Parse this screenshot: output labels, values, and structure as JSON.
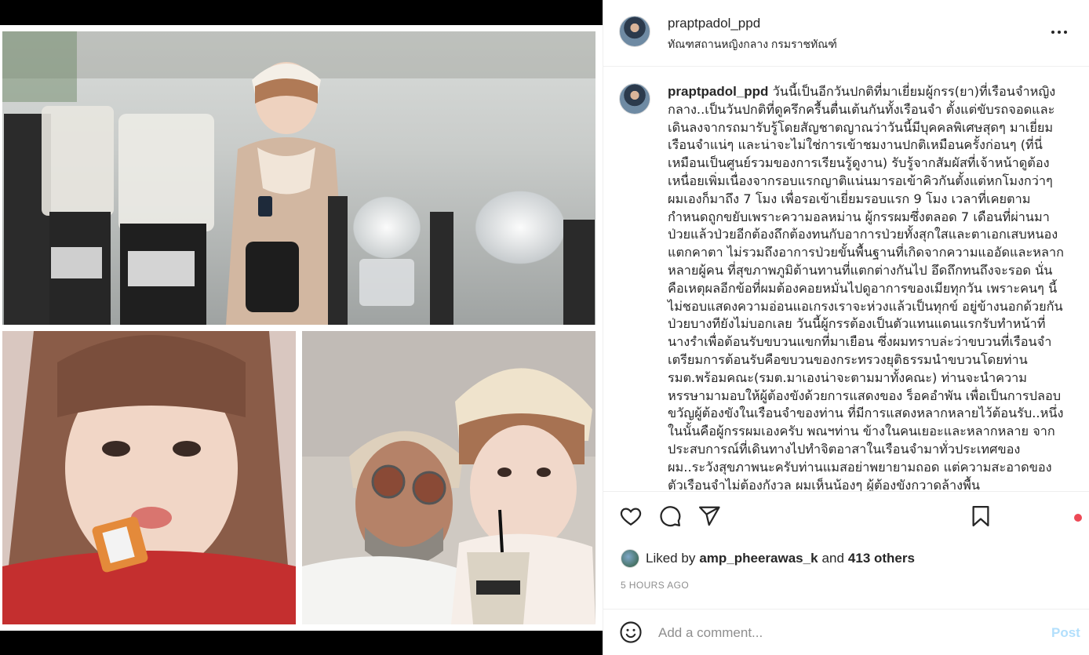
{
  "post": {
    "username": "praptpadol_ppd",
    "location": "ทัณฑสถานหญิงกลาง กรมราชทัณฑ์"
  },
  "caption": {
    "username": "praptpadol_ppd",
    "text": "วันนี้เป็นอีกวันปกติที่มาเยี่ยมผู้กรร(ยา)ที่เรือนจำหญิงกลาง..เป็นวันปกติที่ดูครึกครื้นตื่นเต้นกันทั้งเรือนจำ ตั้งแต่ขับรถจอดและเดินลงจากรถมารับรู้โดยสัญชาตญาณว่าวันนี้มีบุคคลพิเศษสุดๆ มาเยี่ยมเรือนจำแน่ๆ และน่าจะไม่ใช่การเข้าชมงานปกติเหมือนครั้งก่อนๆ (ที่นี่เหมือนเป็นศูนย์รวมของการเรียนรู้ดูงาน) รับรู้จากสัมผัสที่เจ้าหน้าดูต้องเหนื่อยเพิ่มเนื่องจากรอบแรกญาติแน่นมารอเข้าคิวกันตั้งแต่หกโมงกว่าๆ ผมเองก็มาถึง 7 โมง เพื่อรอเข้าเยี่ยมรอบแรก 9 โมง เวลาที่เคยตามกำหนดถูกขยับเพราะความอลหม่าน ผู้กรรผมซึ่งตลอด 7 เดือนที่ผ่านมาป่วยแล้วป่วยอีกต้องถึกต้องทนกับอาการป่วยทั้งสุกใสและตาเอกเสบหนองแตกคาตา ไม่รวมถึงอาการป่วยขั้นพื้นฐานที่เกิดจากความแออัดและหลากหลายผู้คน ที่สุขภาพภูมิต้านทานที่แตกต่างกันไป อึดถึกทนถึงจะรอด นั่นคือเหตุผลอีกข้อที่ผมต้องคอยหมั่นไปดูอาการของเมียทุกวัน เพราะคนๆ นี้ไม่ชอบแสดงความอ่อนแอเกรงเราจะห่วงแล้วเป็นทุกข์ อยู่ข้างนอกด้วยกันป่วยบางทียังไม่บอกเลย วันนี้ผู้กรรต้องเป็นตัวแทนแดนแรกรับทำหน้าที่นางรำเพื่อต้อนรับขบวนแขกที่มาเยือน ซึ่งผมทราบล่ะว่าขบวนที่เรือนจำเตรียมการต้อนรับคือขบวนของกระทรวงยุติธรรมนำขบวนโดยท่าน รมต.พร้อมคณะ(รมต.มาเองน่าจะตามมาทั้งคณะ) ท่านจะนำความหรรษามามอบให้ผู้ต้องขังด้วยการแสดงของ ร็อคอำพัน เพื่อเป็นการปลอบขวัญผู้ต้องขังในเรือนจำของท่าน ที่มีการแสดงหลากหลายไว้ต้อนรับ..หนึ่งในนั้นคือผู้กรรผมเองครับ พณฯท่าน ข้างในคนเยอะและหลากหลาย จากประสบการณ์ที่เดินทางไปทำจิตอาสาในเรือนจำมาทั่วประเทศของผม..ระวังสุขภาพนะครับท่านแมสอย่าพยายามถอด แต่ความสะอาดของตัวเรือนจำไม่ต้องกังวล ผมเห็นน้องๆ ผู้ต้องขังกวาดล้างพื้น"
  },
  "engagement": {
    "liked_prefix": "Liked by",
    "liked_user": "amp_pheerawas_k",
    "liked_and": "and",
    "liked_others": "413 others",
    "timestamp": "5 HOURS AGO"
  },
  "comment_box": {
    "placeholder": "Add a comment...",
    "post_label": "Post"
  },
  "icons": [
    "more-options-icon",
    "heart-icon",
    "comment-icon",
    "share-icon",
    "bookmark-icon",
    "emoji-icon"
  ],
  "colors": {
    "text": "#262626",
    "muted": "#8e8e8e",
    "post_button": "#b2dffc",
    "notification_dot": "#ed4956"
  }
}
